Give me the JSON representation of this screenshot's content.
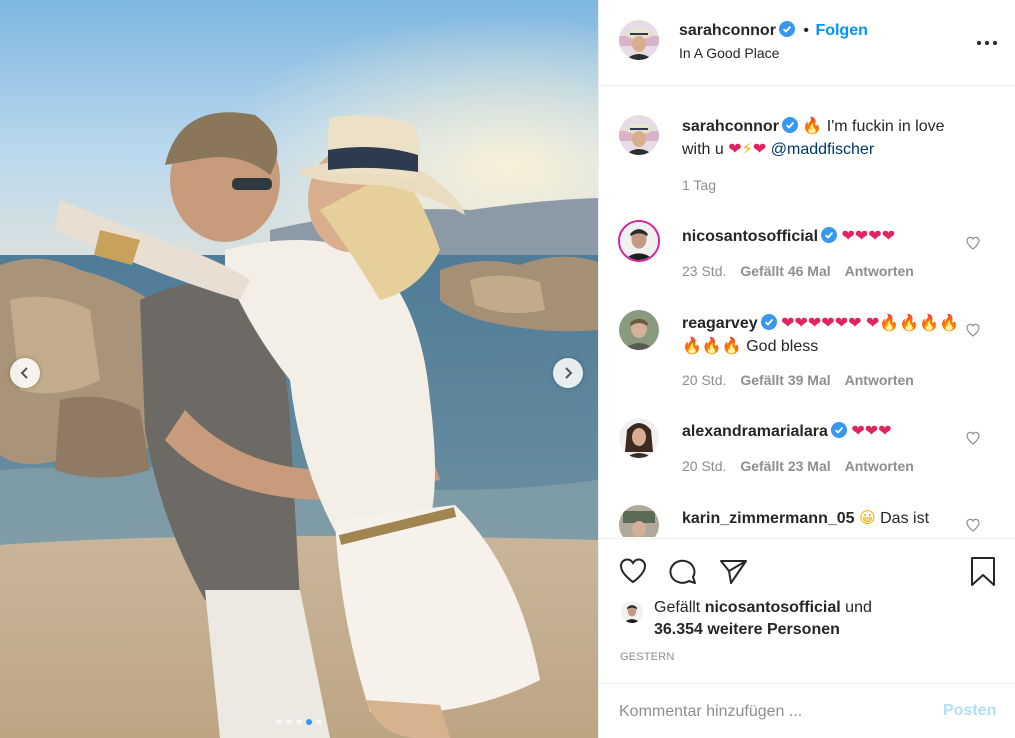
{
  "post": {
    "author": "sarahconnor",
    "follow_label": "Folgen",
    "location": "In A Good Place",
    "more_icon": "more-horizontal-icon"
  },
  "caption": {
    "author": "sarahconnor",
    "text_main": " I'm fuckin in love with u ",
    "mention": "@maddfischer",
    "time": "1 Tag"
  },
  "comments": [
    {
      "user": "nicosantosofficial",
      "verified": true,
      "text": "❤❤❤❤",
      "time": "23 Std.",
      "likes": "Gefällt 46 Mal",
      "reply": "Antworten"
    },
    {
      "user": "reagarvey",
      "verified": true,
      "text": "❤❤❤❤❤❤",
      "text2": "God bless",
      "time": "20 Std.",
      "likes": "Gefällt 39 Mal",
      "reply": "Antworten"
    },
    {
      "user": "alexandramarialara",
      "verified": true,
      "text": "❤❤❤",
      "time": "20 Std.",
      "likes": "Gefällt 23 Mal",
      "reply": "Antworten"
    },
    {
      "user": "karin_zimmermann_05",
      "verified": false,
      "text": "Das ist"
    }
  ],
  "likes": {
    "prefix": "Gefällt ",
    "user": "nicosantosofficial",
    "mid": " und",
    "count_line": "36.354 weitere Personen"
  },
  "date_label": "GESTERN",
  "comment_box": {
    "placeholder": "Kommentar hinzufügen ...",
    "post_label": "Posten"
  },
  "carousel": {
    "slide": 4,
    "total": 5
  },
  "colors": {
    "accent": "#0095f6",
    "verified": "#3897f0",
    "post_disabled": "#b2dffc"
  }
}
